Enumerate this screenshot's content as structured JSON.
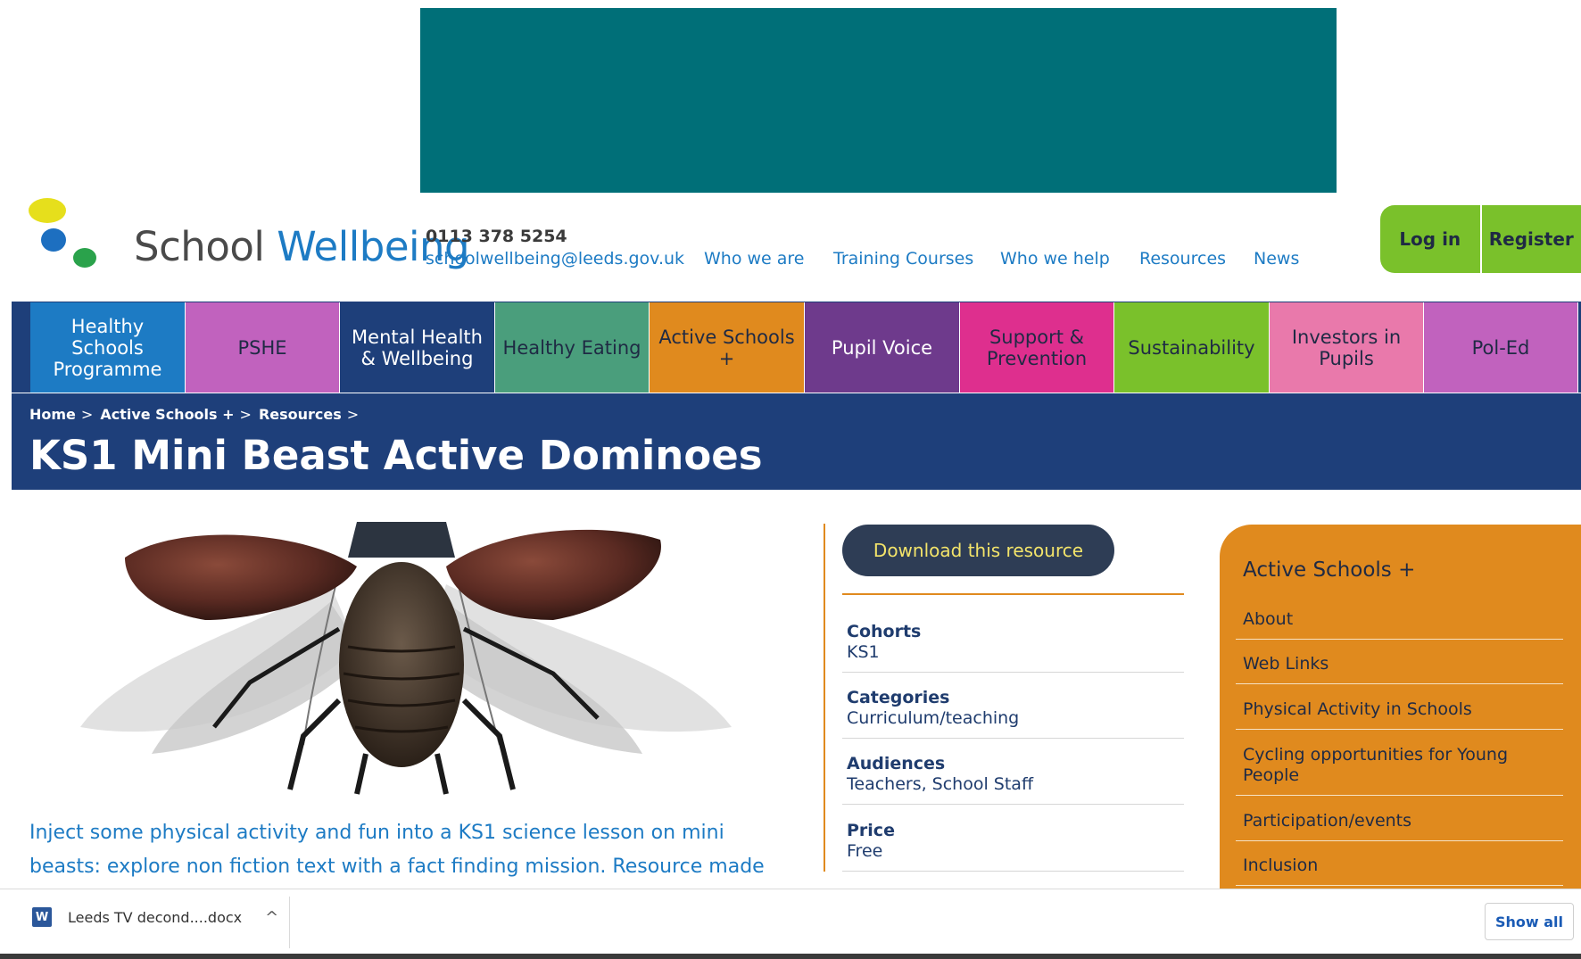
{
  "header": {
    "logo_text_a": "School ",
    "logo_text_b": "Wellbeing",
    "phone": "0113 378 5254",
    "email": "schoolwellbeing@leeds.gov.uk",
    "nav": [
      "Who we are",
      "Training Courses",
      "Who we help",
      "Resources",
      "News"
    ],
    "login": "Log in",
    "register": "Register"
  },
  "categories": [
    {
      "label": "Healthy Schools Programme",
      "color": "#1d7bc4"
    },
    {
      "label": "PSHE",
      "color": "#c162be"
    },
    {
      "label": "Mental Health & Wellbeing",
      "color": "#1e3f7a"
    },
    {
      "label": "Healthy Eating",
      "color": "#4a9e7c"
    },
    {
      "label": "Active Schools +",
      "color": "#e08a1e"
    },
    {
      "label": "Pupil Voice",
      "color": "#6e3a8c"
    },
    {
      "label": "Support & Prevention",
      "color": "#de2f8e"
    },
    {
      "label": "Sustainability",
      "color": "#7ac12b"
    },
    {
      "label": "Investors in Pupils",
      "color": "#e979ab"
    },
    {
      "label": "Pol-Ed",
      "color": "#c162be"
    }
  ],
  "breadcrumb": [
    "Home",
    "Active Schools +",
    "Resources"
  ],
  "breadcrumb_sep": ">",
  "page_title": "KS1 Mini Beast Active Dominoes",
  "description": "Inject some physical activity and fun into a KS1 science lesson on mini beasts: explore non fiction text with a fact finding mission. Resource made in",
  "download_button": "Download this resource",
  "meta": [
    {
      "label": "Cohorts",
      "value": "KS1"
    },
    {
      "label": "Categories",
      "value": "Curriculum/teaching"
    },
    {
      "label": "Audiences",
      "value": "Teachers, School Staff"
    },
    {
      "label": "Price",
      "value": "Free"
    }
  ],
  "sidebar": {
    "title": "Active Schools +",
    "links": [
      "About",
      "Web Links",
      "Physical Activity in Schools",
      "Cycling opportunities for Young People",
      "Participation/events",
      "Inclusion"
    ]
  },
  "downloads": {
    "file_name": "Leeds TV decond....docx",
    "file_icon_letter": "W",
    "chevron": "^",
    "show_all": "Show all"
  }
}
